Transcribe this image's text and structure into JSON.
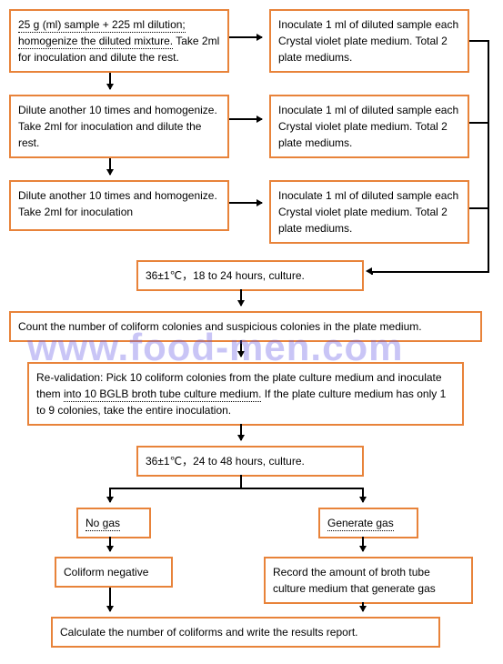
{
  "step1_dilute": {
    "seg1": "25 g (ml) sample + 225 ml dilution;",
    "seg2": "homogenize the diluted mixture.",
    "seg3": " Take 2ml for inoculation and dilute the rest."
  },
  "step1_inoc": "Inoculate 1 ml of diluted sample each Crystal violet plate medium. Total 2 plate mediums.",
  "step2_dilute": "Dilute another 10 times and homogenize. Take 2ml for inoculation and dilute the rest.",
  "step2_inoc": "Inoculate 1 ml of diluted sample each Crystal violet plate medium. Total 2 plate mediums.",
  "step3_dilute": "Dilute another 10 times and homogenize. Take 2ml for inoculation",
  "step3_inoc": "Inoculate 1 ml of diluted sample each Crystal violet plate medium. Total 2 plate mediums.",
  "culture1": "36±1℃，18 to 24 hours, culture.",
  "count": "Count the number of coliform colonies and suspicious colonies in the plate medium.",
  "revalid": {
    "seg1": "Re-validation: Pick 10 coliform colonies from the plate culture medium and inoculate them ",
    "seg2": "into 10 BGLB broth tube culture medium.",
    "seg3": " If the plate culture medium has only 1 to 9 colonies, take the entire inoculation."
  },
  "culture2": "36±1℃，24 to 48 hours, culture.",
  "nogas": "No gas",
  "gengas": "Generate gas",
  "neg": "Coliform negative",
  "record": "Record the amount of broth tube culture medium that generate gas",
  "report": "Calculate the number of coliforms and write the results report.",
  "watermark": "www.food-men.com"
}
